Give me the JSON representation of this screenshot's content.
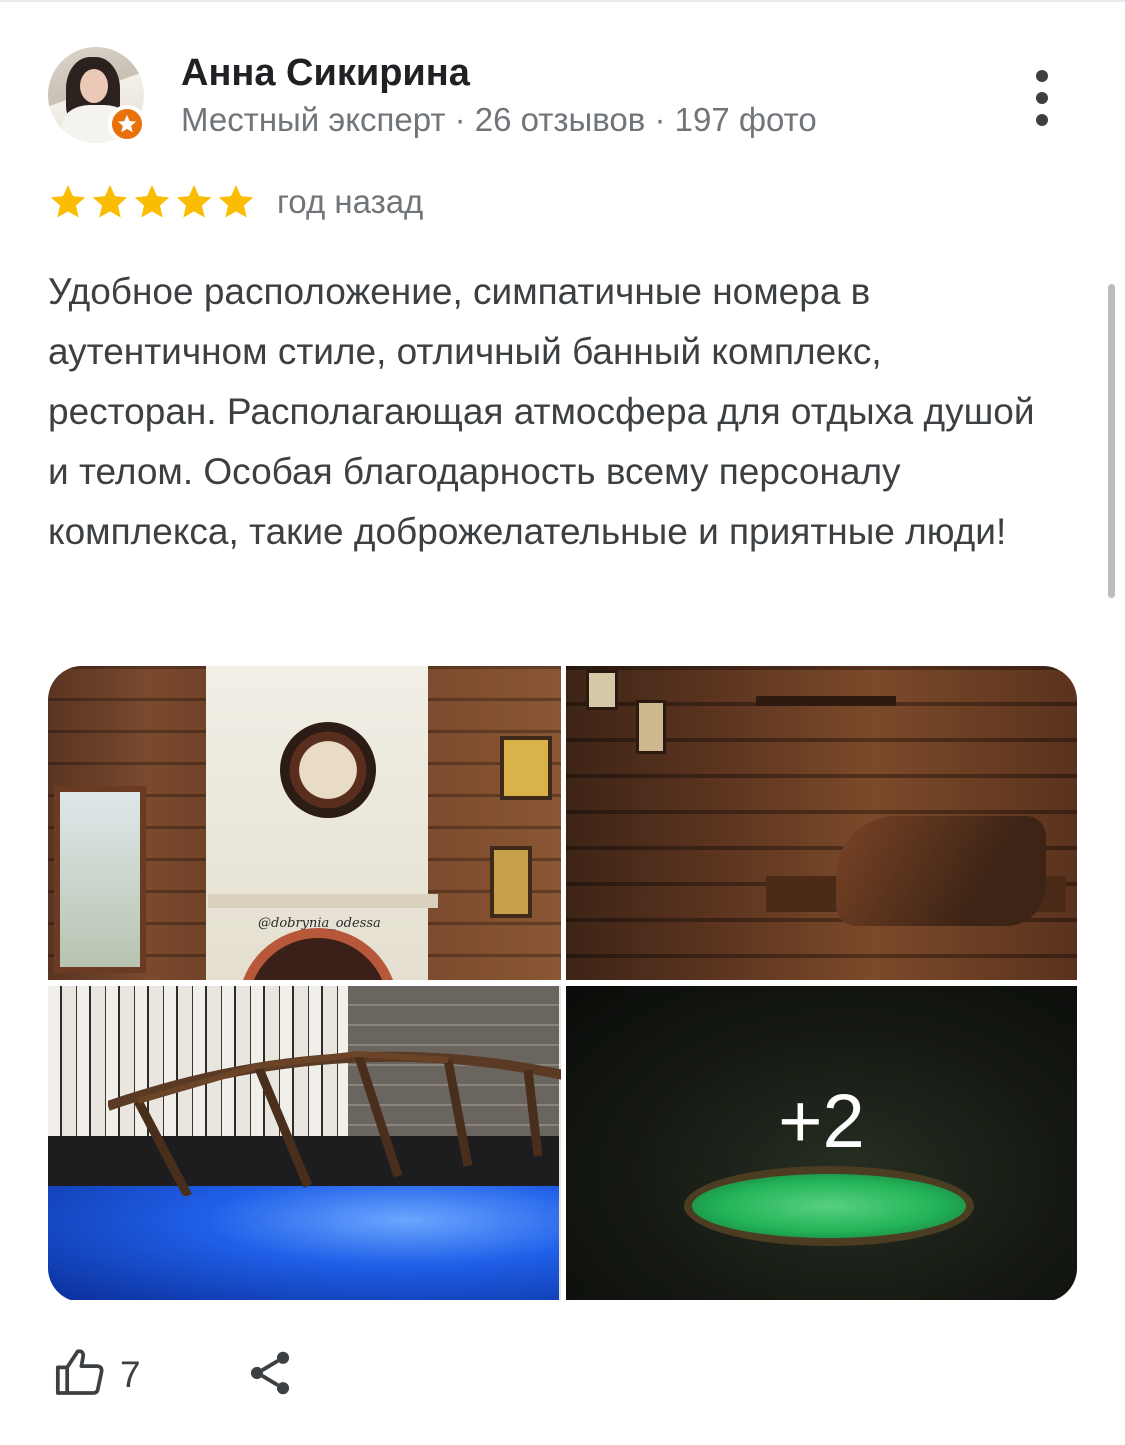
{
  "review": {
    "author": {
      "name": "Анна Сикирина",
      "meta": "Местный эксперт · 26 отзывов · 197 фото"
    },
    "rating": 5,
    "time": "год назад",
    "text": "Удобное расположение, симпатичные номера в аутентичном стиле, отличный банный комплекс, ресторан. Располагающая атмосфера для отдыха душой и телом. Особая благодарность всему персоналу комплекса, такие доброжелательные и приятные люди!",
    "photos": {
      "logo_text": "@dobrynia_odessa",
      "more_label": "+2"
    },
    "likes": "7"
  },
  "icons": {
    "more": "more-vert-icon",
    "star": "star-icon",
    "badge": "local-guide-badge-icon",
    "like": "thumb-up-icon",
    "share": "share-icon"
  },
  "colors": {
    "star": "#fbbc04",
    "badge": "#e8710a",
    "name": "#202124",
    "secondary": "#70757a",
    "body": "#3c4043"
  }
}
